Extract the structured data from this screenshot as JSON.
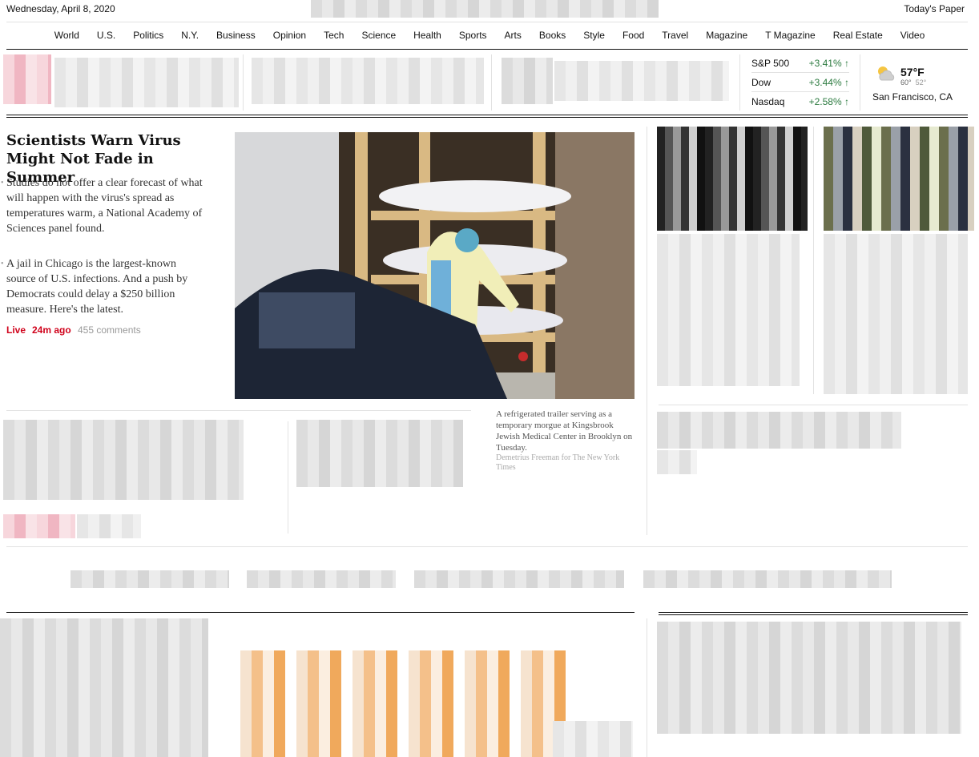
{
  "header": {
    "date": "Wednesday, April 8, 2020",
    "todays_paper": "Today's Paper"
  },
  "nav": {
    "sections": [
      "World",
      "U.S.",
      "Politics",
      "N.Y.",
      "Business",
      "Opinion",
      "Tech",
      "Science",
      "Health",
      "Sports",
      "Arts",
      "Books",
      "Style",
      "Food",
      "Travel",
      "Magazine",
      "T Magazine",
      "Real Estate",
      "Video"
    ]
  },
  "markets": [
    {
      "name": "S&P 500",
      "change": "+3.41%"
    },
    {
      "name": "Dow",
      "change": "+3.44%"
    },
    {
      "name": "Nasdaq",
      "change": "+2.58%"
    }
  ],
  "weather": {
    "temp": "57°F",
    "high": "60°",
    "low": "52°",
    "city": "San Francisco, CA"
  },
  "lead": {
    "headline": "Scientists Warn Virus Might Not Fade in Summer",
    "summary_1": "Studies do not offer a clear forecast of what will happen with the virus's spread as temperatures warm, a National Academy of Sciences panel found.",
    "summary_2": "A jail in Chicago is the largest-known source of U.S. infections. And a push by Democrats could delay a $250 billion measure. Here's the latest.",
    "live": "Live",
    "time": "24m ago",
    "comments": "455 comments",
    "caption": "A refrigerated trailer serving as a temporary morgue at Kingsbrook Jewish Medical Center in Brooklyn on Tuesday.",
    "credit": "Demetrius Freeman for The New York Times"
  },
  "colors": {
    "live_red": "#d0021b",
    "market_green": "#2b7a3f"
  }
}
